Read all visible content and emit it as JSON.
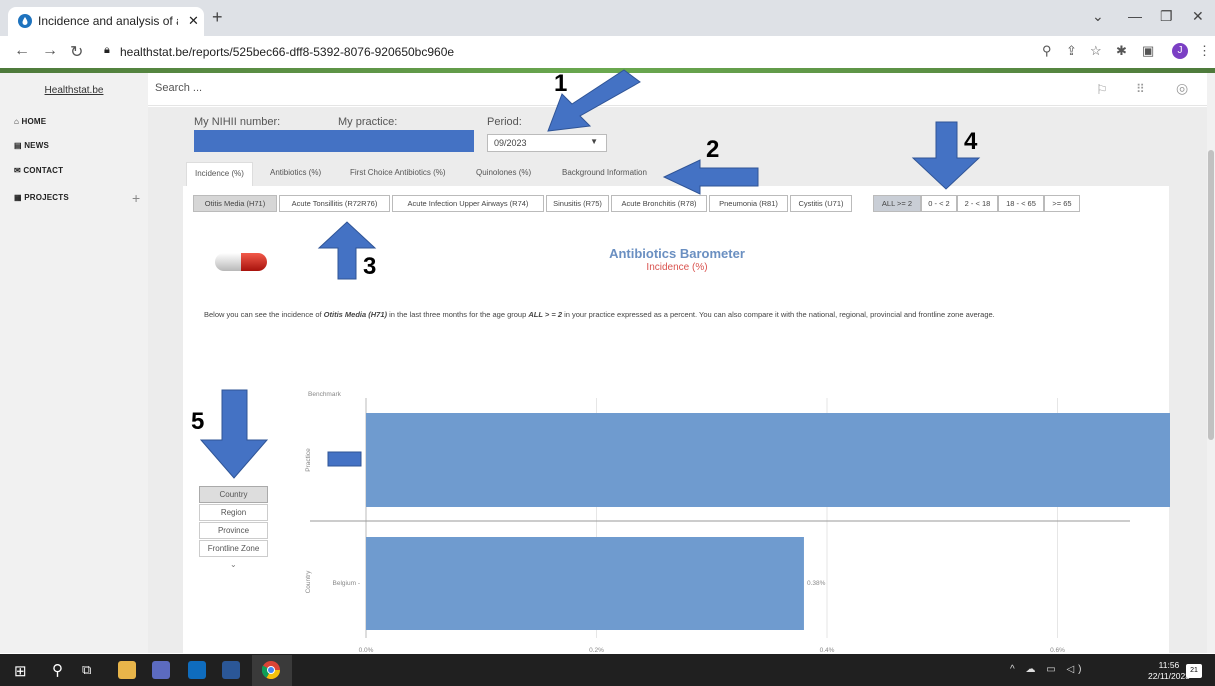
{
  "browser": {
    "tab_title": "Incidence and analysis of antibio",
    "url": "healthstat.be/reports/525bec66-dff8-5392-8076-920650bc960e",
    "avatar_letter": "J"
  },
  "sidebar": {
    "brand": "Healthstat.be",
    "items": [
      {
        "label": "HOME",
        "icon": "home-icon"
      },
      {
        "label": "NEWS",
        "icon": "newspaper-icon"
      },
      {
        "label": "CONTACT",
        "icon": "envelope-icon"
      },
      {
        "label": "PROJECTS",
        "icon": "book-icon"
      }
    ],
    "add_label": "+"
  },
  "topbar": {
    "search_placeholder": "Search ..."
  },
  "filters": {
    "nihii_label": "My NIHII number:",
    "practice_label": "My practice:",
    "period_label": "Period:",
    "period_value": "09/2023"
  },
  "tabs": [
    "Incidence (%)",
    "Antibiotics (%)",
    "First Choice Antibiotics (%)",
    "Quinolones (%)",
    "Background Information"
  ],
  "pathologies": [
    "Otitis Media (H71)",
    "Acute Tonsillitis (R72R76)",
    "Acute Infection Upper Airways (R74)",
    "Sinusitis (R75)",
    "Acute Bronchitis (R78)",
    "Pneumonia (R81)",
    "Cystitis (U71)"
  ],
  "age_groups": [
    "ALL >= 2",
    "0 - < 2",
    "2 - < 18",
    "18 - < 65",
    ">= 65"
  ],
  "report": {
    "title": "Antibiotics Barometer",
    "subtitle": "Incidence (%)",
    "desc_pre": "Below you can see the incidence of ",
    "desc_condition": "Otitis Media (H71)",
    "desc_mid": " in the last three months for the age group ",
    "desc_age": "ALL > = 2",
    "desc_post": " in your practice expressed as a percent. You can also compare it with the national, regional, provincial and frontline zone average."
  },
  "levels": [
    "Country",
    "Region",
    "Province",
    "Frontline Zone"
  ],
  "annotations": [
    "1",
    "2",
    "3",
    "4",
    "5"
  ],
  "chart_data": {
    "type": "bar",
    "orientation": "horizontal",
    "facet_label": "Benchmark",
    "groups": [
      {
        "group": "Practice",
        "category": "",
        "value": 0.72,
        "label": "0.72%"
      },
      {
        "group": "Country",
        "category": "Belgium",
        "value": 0.38,
        "label": "0.38%"
      }
    ],
    "x_ticks": [
      "0.0%",
      "0.2%",
      "0.4%",
      "0.6%"
    ],
    "xlim": [
      0,
      0.8
    ],
    "color": "#6f9bcf"
  },
  "taskbar": {
    "time": "11:56",
    "date": "22/11/2023",
    "notif_count": "21"
  }
}
